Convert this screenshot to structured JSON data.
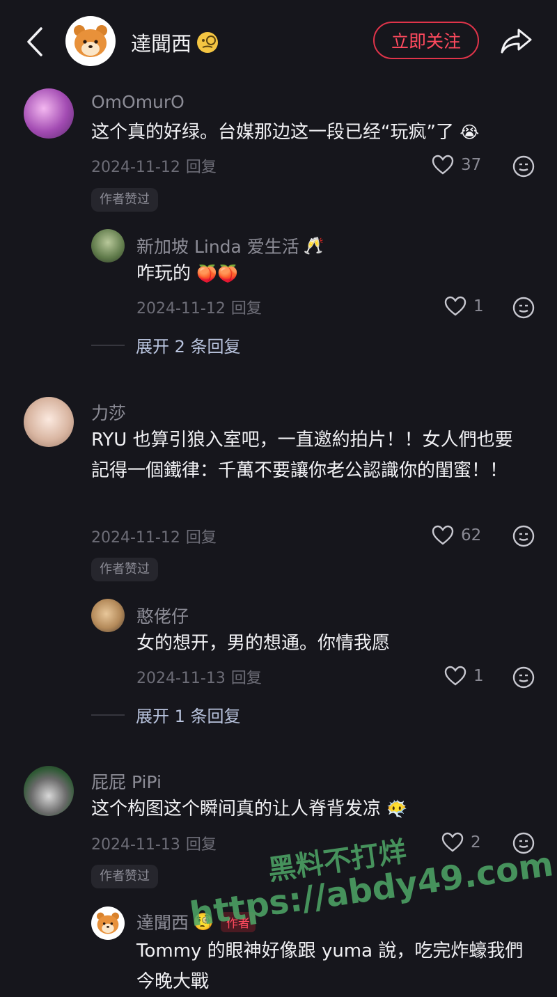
{
  "header": {
    "title": "達聞西",
    "follow_label": "立即关注"
  },
  "comments": [
    {
      "username": "OmOmurO",
      "text": "这个真的好绿。台媒那边这一段已经“玩疯”了",
      "date": "2024-11-12",
      "reply_label": "回复",
      "likes": "37",
      "author_liked": "作者赞过"
    },
    {
      "username": "新加坡 Linda 爱生活",
      "text": "咋玩的",
      "date": "2024-11-12",
      "reply_label": "回复",
      "likes": "1",
      "expand": "展开 2 条回复"
    },
    {
      "username": "力莎",
      "text": "RYU 也算引狼入室吧，一直邀約拍片！！女人們也要記得一個鐵律：千萬不要讓你老公認識你的閨蜜！！",
      "date": "2024-11-12",
      "reply_label": "回复",
      "likes": "62",
      "author_liked": "作者赞过"
    },
    {
      "username": "憨佬仔",
      "text": "女的想开，男的想通。你情我愿",
      "date": "2024-11-13",
      "reply_label": "回复",
      "likes": "1",
      "expand": "展开 1 条回复"
    },
    {
      "username": "屁屁 PiPi",
      "text": "这个构图这个瞬间真的让人脊背发凉",
      "date": "2024-11-13",
      "reply_label": "回复",
      "likes": "2",
      "author_liked": "作者赞过"
    },
    {
      "username": "達聞西",
      "author_tag": "作者",
      "text": "Tommy 的眼神好像跟 yuma 說，吃完炸蠔我們今晚大戰"
    }
  ],
  "watermark": {
    "line1": "黑料不打烊",
    "line2": "https://abdy49.com"
  },
  "colors": {
    "background": "#16161c",
    "accent": "#e0344a",
    "watermark": "#4fa868"
  }
}
